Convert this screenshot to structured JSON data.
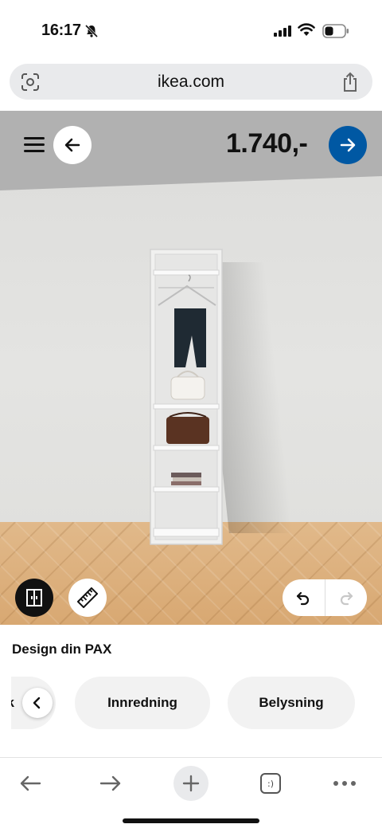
{
  "status_bar": {
    "time": "16:17"
  },
  "browser": {
    "url": "ikea.com"
  },
  "configurator": {
    "price": "1.740,-",
    "section_title": "Design din PAX",
    "chips": [
      "ak",
      "Innredning",
      "Belysning"
    ]
  },
  "colors": {
    "ikea_blue": "#0058a3",
    "ceiling": "#b1b1b1",
    "floor": "#dfae7a"
  },
  "icons": {
    "menu": "hamburger-icon",
    "back": "arrow-left-icon",
    "next": "arrow-right-icon",
    "view": "wardrobe-front-icon",
    "measure": "ruler-icon",
    "undo": "undo-icon",
    "redo": "redo-icon",
    "tabs_label": ":)"
  }
}
